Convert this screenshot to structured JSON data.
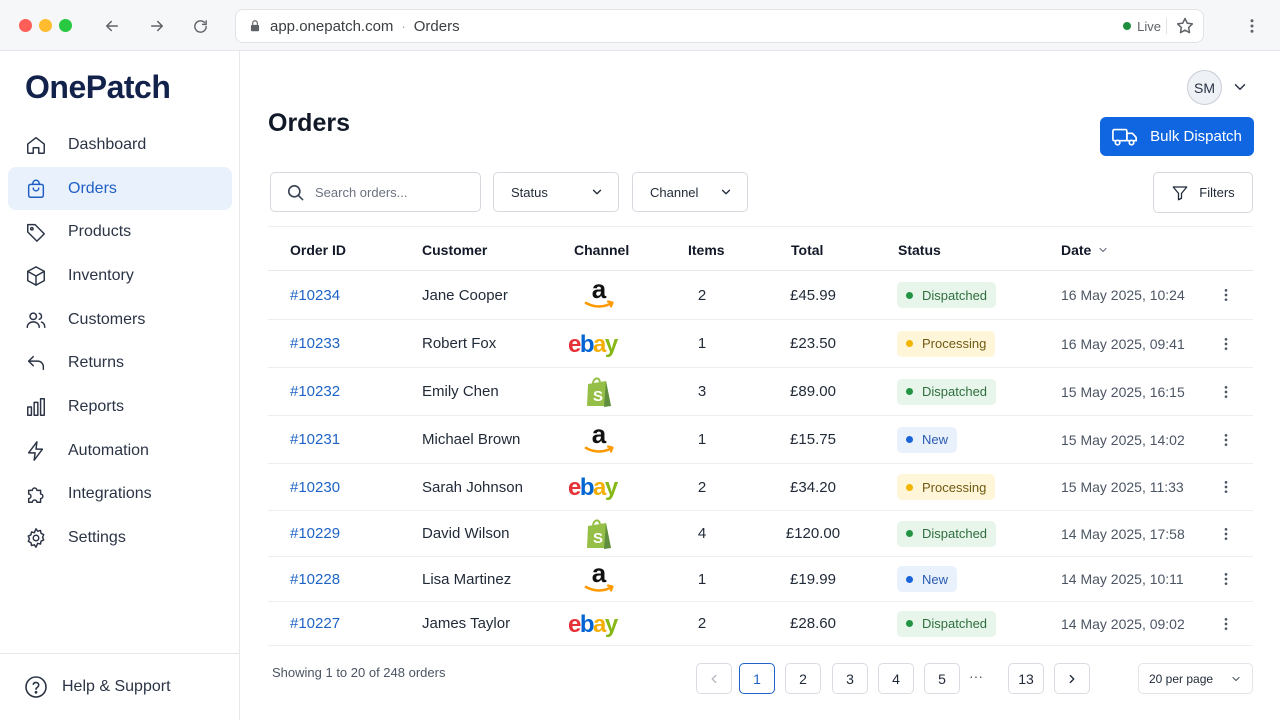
{
  "browser": {
    "url_domain": "app.onepatch.com",
    "url_separator": "·",
    "url_page": "Orders",
    "live_label": "Live"
  },
  "sidebar": {
    "logo": "OnePatch",
    "items": [
      {
        "label": "Dashboard",
        "icon": "home-icon",
        "active": false
      },
      {
        "label": "Orders",
        "icon": "shopping-bag-icon",
        "active": true
      },
      {
        "label": "Products",
        "icon": "tag-icon",
        "active": false
      },
      {
        "label": "Inventory",
        "icon": "box-icon",
        "active": false
      },
      {
        "label": "Customers",
        "icon": "users-icon",
        "active": false
      },
      {
        "label": "Returns",
        "icon": "return-arrow-icon",
        "active": false
      },
      {
        "label": "Reports",
        "icon": "bar-chart-icon",
        "active": false
      },
      {
        "label": "Automation",
        "icon": "lightning-icon",
        "active": false
      },
      {
        "label": "Integrations",
        "icon": "puzzle-icon",
        "active": false
      },
      {
        "label": "Settings",
        "icon": "gear-icon",
        "active": false
      }
    ],
    "help_label": "Help & Support"
  },
  "header": {
    "title": "Orders",
    "avatar_initials": "SM",
    "bulk_button_label": "Bulk Dispatch"
  },
  "toolbar": {
    "search_placeholder": "Search orders...",
    "status_select": "Status",
    "channel_select": "Channel",
    "filters_label": "Filters"
  },
  "table": {
    "columns": [
      "Order ID",
      "Customer",
      "Channel",
      "Items",
      "Total",
      "Status",
      "Date"
    ],
    "rows": [
      {
        "id": "#10234",
        "customer": "Jane Cooper",
        "channel": "amazon",
        "items": "2",
        "total": "£45.99",
        "status": "Dispatched",
        "date": "16 May 2025, 10:24"
      },
      {
        "id": "#10233",
        "customer": "Robert Fox",
        "channel": "ebay",
        "items": "1",
        "total": "£23.50",
        "status": "Processing",
        "date": "16 May 2025, 09:41"
      },
      {
        "id": "#10232",
        "customer": "Emily Chen",
        "channel": "shopify",
        "items": "3",
        "total": "£89.00",
        "status": "Dispatched",
        "date": "15 May 2025, 16:15"
      },
      {
        "id": "#10231",
        "customer": "Michael Brown",
        "channel": "amazon",
        "items": "1",
        "total": "£15.75",
        "status": "New",
        "date": "15 May 2025, 14:02"
      },
      {
        "id": "#10230",
        "customer": "Sarah Johnson",
        "channel": "ebay",
        "items": "2",
        "total": "£34.20",
        "status": "Processing",
        "date": "15 May 2025, 11:33"
      },
      {
        "id": "#10229",
        "customer": "David Wilson",
        "channel": "shopify",
        "items": "4",
        "total": "£120.00",
        "status": "Dispatched",
        "date": "14 May 2025, 17:58"
      },
      {
        "id": "#10228",
        "customer": "Lisa Martinez",
        "channel": "amazon",
        "items": "1",
        "total": "£19.99",
        "status": "New",
        "date": "14 May 2025, 10:11"
      },
      {
        "id": "#10227",
        "customer": "James Taylor",
        "channel": "ebay",
        "items": "2",
        "total": "£28.60",
        "status": "Dispatched",
        "date": "14 May 2025, 09:02"
      }
    ]
  },
  "pagination": {
    "showing": "Showing 1 to 20 of 248 orders",
    "pages": [
      "1",
      "2",
      "3",
      "4",
      "5"
    ],
    "ellipsis": "···",
    "last_page": "13",
    "current_page": "1",
    "per_page": "20 per page"
  },
  "colors": {
    "accent": "#0f66e0",
    "dispatched": "#239443",
    "processing": "#f2b600",
    "new": "#1a63d9"
  }
}
